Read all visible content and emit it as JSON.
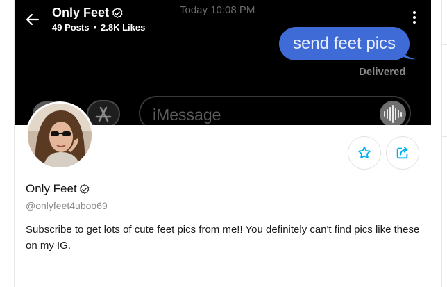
{
  "header": {
    "name": "Only Feet",
    "posts": "49 Posts",
    "separator": "•",
    "likes": "2.8K Likes"
  },
  "banner": {
    "timestamp": "Today 10:08 PM",
    "message": "send feet pics",
    "status": "Delivered",
    "input_placeholder": "iMessage",
    "bubble_color": "#3f6bd6"
  },
  "profile": {
    "name": "Only Feet",
    "handle": "@onlyfeet4uboo69",
    "bio": "Subscribe to get lots of cute feet pics from me!! You definitely can't find pics like these on my IG."
  },
  "icons": {
    "back": "back-arrow-icon",
    "verified": "verified-badge-icon",
    "more": "more-vertical-icon",
    "favorite": "star-icon",
    "share": "share-icon",
    "audio": "audio-waveform-icon",
    "camera": "camera-icon",
    "appstore": "app-store-icon"
  },
  "colors": {
    "accent": "#00aff0",
    "banner_bg": "#000000"
  }
}
